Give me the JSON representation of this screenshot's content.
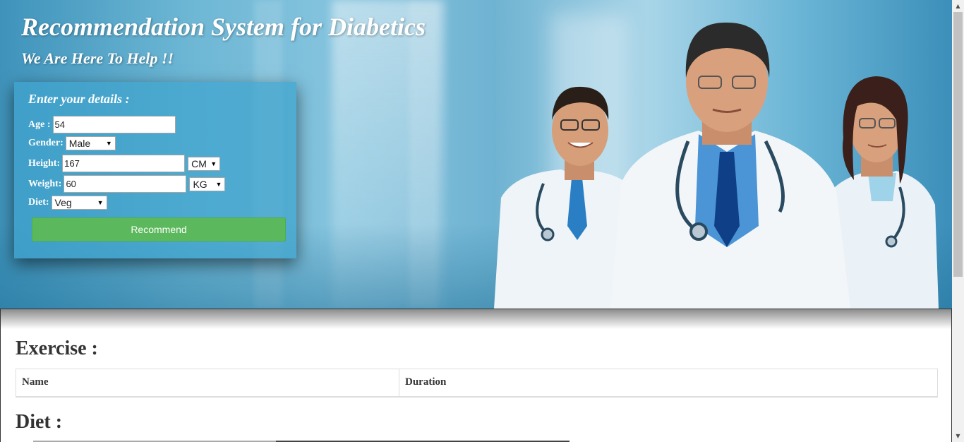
{
  "header": {
    "title": "Recommendation System for Diabetics",
    "tagline": "We Are Here To Help !!"
  },
  "form": {
    "title": "Enter your details :",
    "age": {
      "label": "Age :",
      "value": "54"
    },
    "gender": {
      "label": "Gender:",
      "selected": "Male"
    },
    "height": {
      "label": "Height:",
      "value": "167",
      "unit": "CM"
    },
    "weight": {
      "label": "Weight:",
      "value": "60",
      "unit": "KG"
    },
    "diet": {
      "label": "Diet:",
      "selected": "Veg"
    },
    "submit_label": "Recommend"
  },
  "exercise": {
    "heading": "Exercise :",
    "columns": [
      "Name",
      "Duration"
    ]
  },
  "diet_section": {
    "heading": "Diet :"
  },
  "colors": {
    "button": "#5cb85c",
    "panel": "#40a4cd",
    "hero": "#6db7d5"
  }
}
